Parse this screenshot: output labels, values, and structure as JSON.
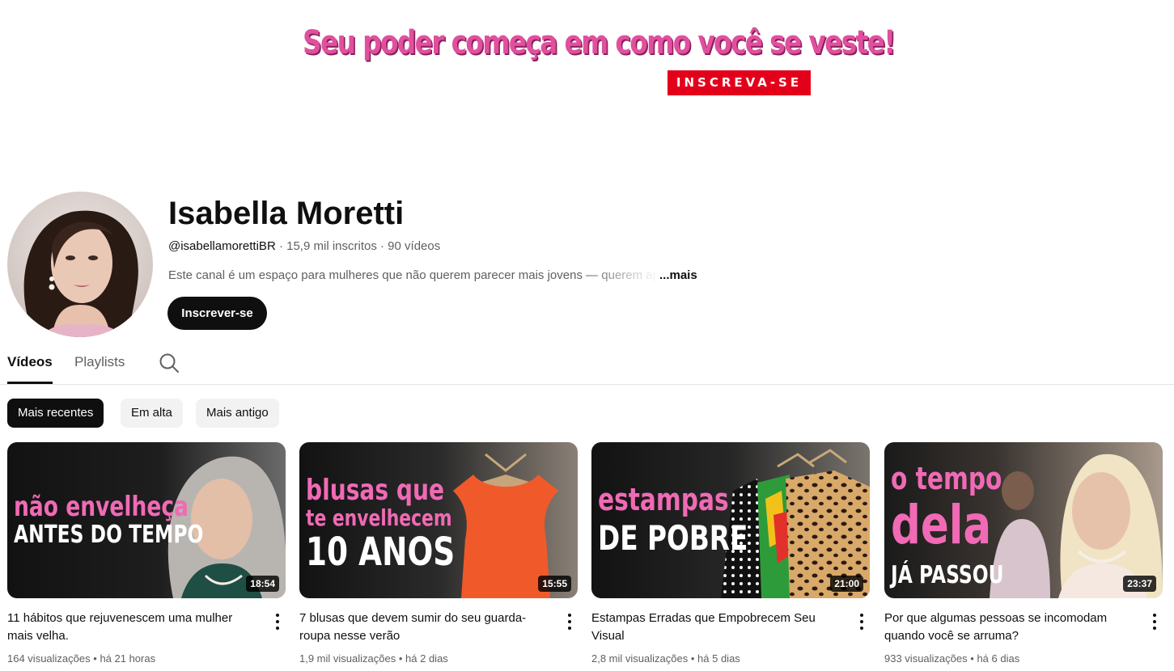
{
  "banner": {
    "slogan": "Seu poder começa em como você se veste!",
    "cta": "INSCREVA-SE"
  },
  "channel": {
    "name": "Isabella Moretti",
    "handle": "@isabellamorettiBR",
    "subscribers": "15,9 mil inscritos",
    "videos_count": "90 vídeos",
    "separator": "·",
    "description": "Este canal é um espaço para mulheres que não querem parecer mais jovens — querem ap",
    "more_label": "...mais",
    "subscribe_label": "Inscrever-se"
  },
  "tabs": [
    {
      "label": "Vídeos",
      "active": true
    },
    {
      "label": "Playlists",
      "active": false
    }
  ],
  "chips": [
    {
      "label": "Mais recentes",
      "active": true
    },
    {
      "label": "Em alta",
      "active": false
    },
    {
      "label": "Mais antigo",
      "active": false
    }
  ],
  "videos": [
    {
      "thumb_lines": [
        "não envelheça",
        "ANTES DO TEMPO"
      ],
      "duration": "18:54",
      "title": "11 hábitos que rejuvenescem uma mulher mais velha.",
      "views": "164 visualizações",
      "age": "há 21 horas"
    },
    {
      "thumb_lines": [
        "blusas que",
        "te envelhecem",
        "10 ANOS"
      ],
      "duration": "15:55",
      "title": "7 blusas que devem sumir do seu guarda-roupa nesse verão",
      "views": "1,9 mil visualizações",
      "age": "há 2 dias"
    },
    {
      "thumb_lines": [
        "estampas",
        "DE POBRE"
      ],
      "duration": "21:00",
      "title": "Estampas Erradas que Empobrecem Seu Visual",
      "views": "2,8 mil visualizações",
      "age": "há 5 dias"
    },
    {
      "thumb_lines": [
        "o tempo",
        "dela",
        "JÁ PASSOU"
      ],
      "duration": "23:37",
      "title": "Por que algumas pessoas se incomodam quando você se arruma?",
      "views": "933 visualizações",
      "age": "há 6 dias"
    }
  ],
  "meta_separator": "•",
  "colors": {
    "accent_pink": "#f06ab5",
    "cta_red": "#e3001b",
    "button_dark": "#0f0f0f"
  }
}
